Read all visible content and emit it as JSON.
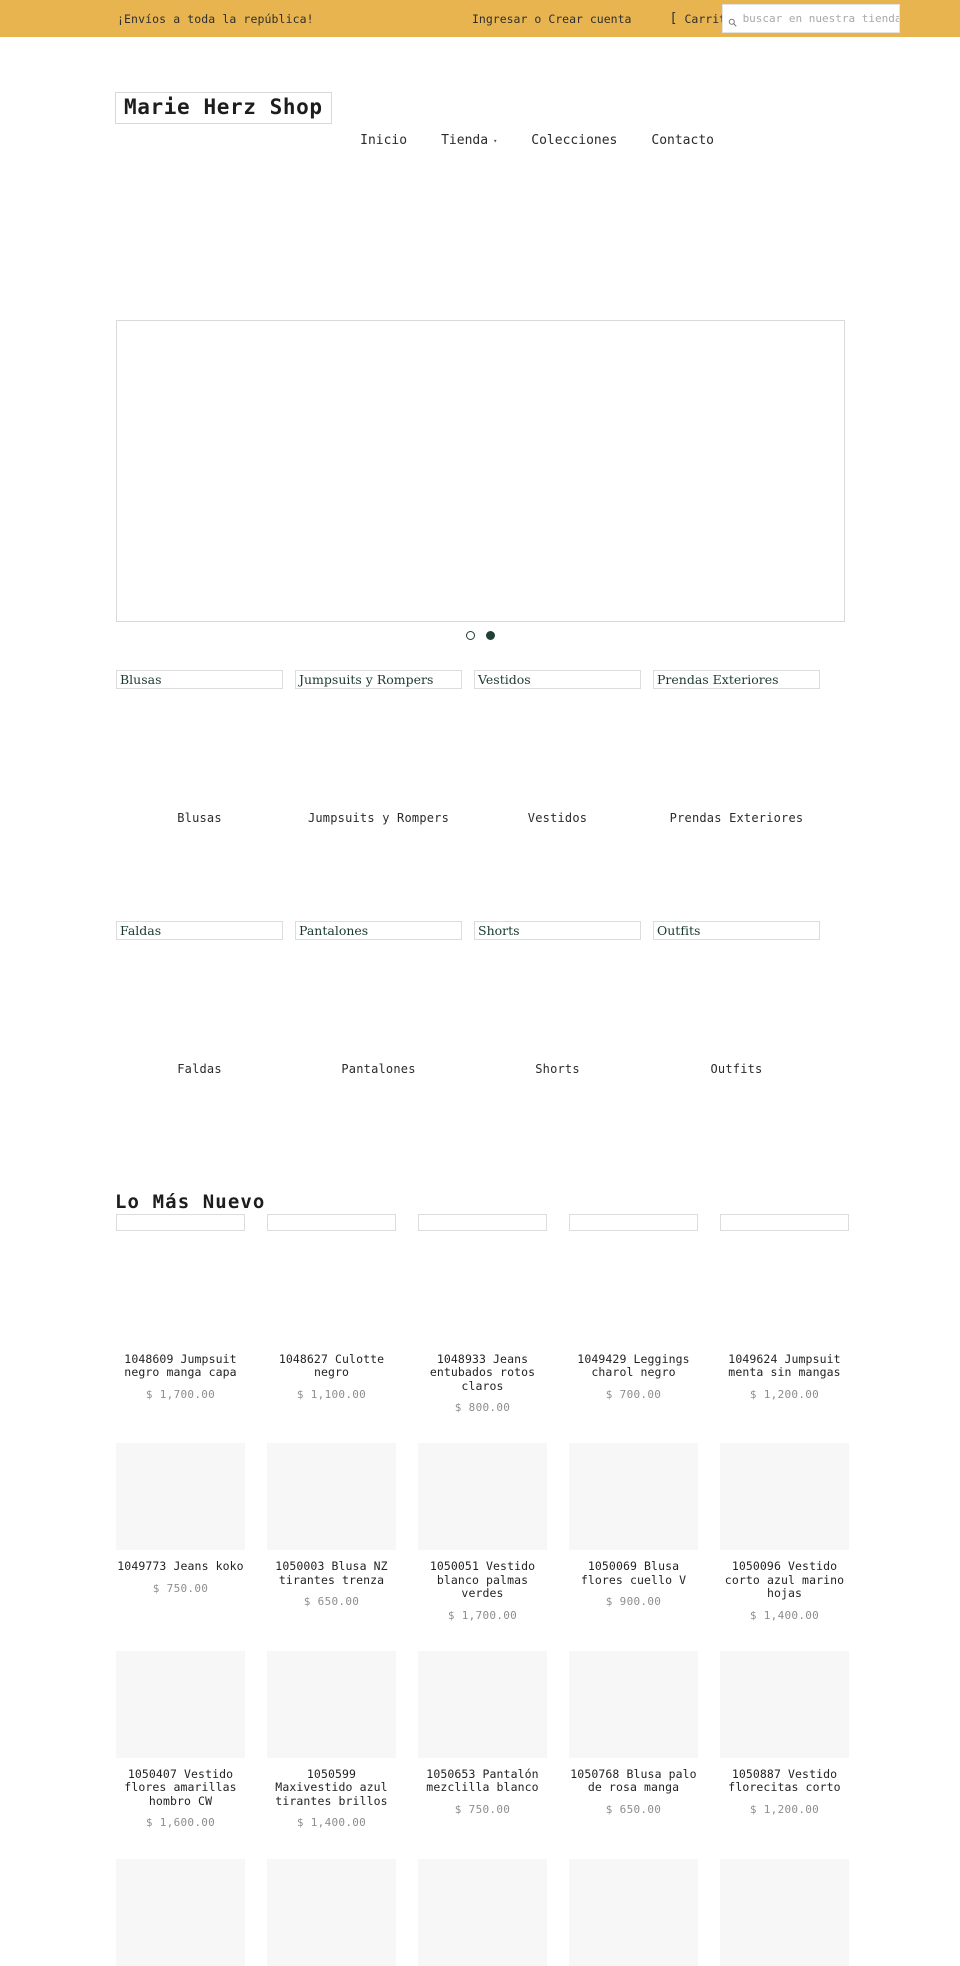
{
  "announcement": {
    "message": "¡Envíos a toda la república!",
    "login_label": "Ingresar",
    "separator": "o",
    "register_label": "Crear cuenta",
    "cart_label": "Carrito",
    "cart_icon": "shopping-bag-icon",
    "search_icon": "search-icon",
    "search_placeholder": "buscar en nuestra tienda",
    "bar_color": "#e8b44f"
  },
  "header": {
    "logo": "Marie Herz Shop",
    "nav": [
      {
        "label": "Inicio",
        "has_caret": false
      },
      {
        "label": "Tienda",
        "has_caret": true,
        "caret": "▾"
      },
      {
        "label": "Colecciones",
        "has_caret": false
      },
      {
        "label": "Contacto",
        "has_caret": false
      }
    ]
  },
  "hero": {
    "dots": [
      {
        "state": "hollow"
      },
      {
        "state": "filled"
      }
    ],
    "accent_color": "#1f4136"
  },
  "collections": {
    "row1": [
      {
        "alt": "Blusas",
        "caption": "Blusas"
      },
      {
        "alt": "Jumpsuits y Rompers",
        "caption": "Jumpsuits y Rompers"
      },
      {
        "alt": "Vestidos",
        "caption": "Vestidos"
      },
      {
        "alt": "Prendas Exteriores",
        "caption": "Prendas Exteriores"
      }
    ],
    "row2": [
      {
        "alt": "Faldas",
        "caption": "Faldas"
      },
      {
        "alt": "Pantalones",
        "caption": "Pantalones"
      },
      {
        "alt": "Shorts",
        "caption": "Shorts"
      },
      {
        "alt": "Outfits",
        "caption": "Outfits"
      }
    ]
  },
  "products": {
    "section_title": "Lo Más Nuevo",
    "rows": [
      {
        "image_style": "empty-box",
        "items": [
          {
            "title": "1048609 Jumpsuit negro manga capa",
            "price": "$ 1,700.00"
          },
          {
            "title": "1048627 Culotte negro",
            "price": "$ 1,100.00"
          },
          {
            "title": "1048933 Jeans entubados rotos claros",
            "price": "$ 800.00"
          },
          {
            "title": "1049429 Leggings charol negro",
            "price": "$ 700.00"
          },
          {
            "title": "1049624 Jumpsuit menta sin mangas",
            "price": "$ 1,200.00"
          }
        ]
      },
      {
        "image_style": "gray-block",
        "items": [
          {
            "title": "1049773 Jeans koko",
            "price": "$ 750.00"
          },
          {
            "title": "1050003 Blusa NZ tirantes trenza",
            "price": "$ 650.00"
          },
          {
            "title": "1050051 Vestido blanco palmas verdes",
            "price": "$ 1,700.00"
          },
          {
            "title": "1050069 Blusa flores cuello V",
            "price": "$ 900.00"
          },
          {
            "title": "1050096 Vestido corto azul marino hojas",
            "price": "$ 1,400.00"
          }
        ]
      },
      {
        "image_style": "gray-block",
        "items": [
          {
            "title": "1050407 Vestido flores amarillas hombro CW",
            "price": "$ 1,600.00"
          },
          {
            "title": "1050599 Maxivestido azul tirantes brillos",
            "price": "$ 1,400.00"
          },
          {
            "title": "1050653 Pantalón mezclilla blanco",
            "price": "$ 750.00"
          },
          {
            "title": "1050768 Blusa palo de rosa manga",
            "price": "$ 650.00"
          },
          {
            "title": "1050887 Vestido florecitas corto",
            "price": "$ 1,200.00"
          }
        ]
      },
      {
        "image_style": "gray-block-partial",
        "items": [
          {
            "title": "",
            "price": ""
          },
          {
            "title": "",
            "price": ""
          },
          {
            "title": "",
            "price": ""
          },
          {
            "title": "",
            "price": ""
          },
          {
            "title": "",
            "price": ""
          }
        ]
      }
    ]
  }
}
